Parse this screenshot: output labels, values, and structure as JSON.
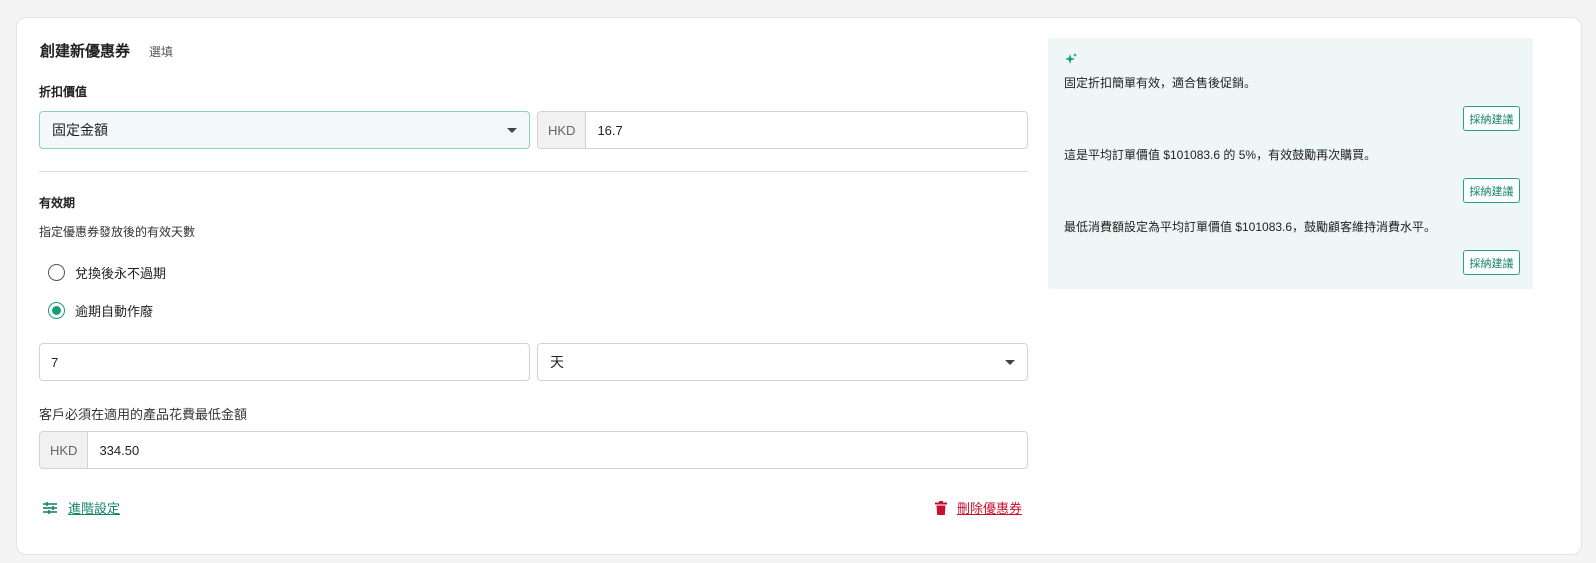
{
  "header": {
    "title": "創建新優惠券",
    "optional_tag": "選填"
  },
  "discount": {
    "label": "折扣價值",
    "type_selected": "固定金額",
    "currency": "HKD",
    "amount": "16.7"
  },
  "validity": {
    "label": "有效期",
    "description": "指定優惠券發放後的有效天數",
    "options": [
      {
        "label": "兌換後永不過期",
        "checked": false
      },
      {
        "label": "逾期自動作廢",
        "checked": true
      }
    ],
    "duration_value": "7",
    "duration_unit": "天"
  },
  "min_spend": {
    "label": "客戶必須在適用的產品花費最低金額",
    "currency": "HKD",
    "amount": "334.50"
  },
  "footer": {
    "advanced_label": "進階設定",
    "delete_label": "刪除優惠券"
  },
  "suggestions": {
    "items": [
      {
        "text": "固定折扣簡單有效，適合售後促銷。",
        "button": "採納建議"
      },
      {
        "text": "這是平均訂單價值 $101083.6 的 5%，有效鼓勵再次購買。",
        "button": "採納建議"
      },
      {
        "text": "最低消費額設定為平均訂單價值 $101083.6，鼓勵顧客維持消費水平。",
        "button": "採納建議"
      }
    ]
  },
  "colors": {
    "accent": "#1a9a7a",
    "danger": "#c8102e",
    "panel_bg": "#eef7f5"
  }
}
